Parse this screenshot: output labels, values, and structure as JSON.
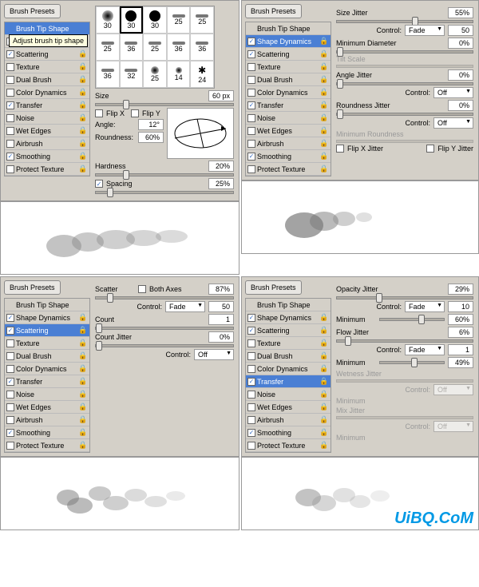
{
  "common": {
    "brush_presets_btn": "Brush Presets",
    "options": {
      "brush_tip_shape": "Brush Tip Shape",
      "shape_dynamics": "Shape Dynamics",
      "scattering": "Scattering",
      "texture": "Texture",
      "dual_brush": "Dual Brush",
      "color_dynamics": "Color Dynamics",
      "transfer": "Transfer",
      "noise": "Noise",
      "wet_edges": "Wet Edges",
      "airbrush": "Airbrush",
      "smoothing": "Smoothing",
      "protect_texture": "Protect Texture"
    },
    "tooltip": "Adjust brush tip shape",
    "control_label": "Control:",
    "fade": "Fade",
    "off": "Off"
  },
  "p1": {
    "brushes": [
      "30",
      "30",
      "30",
      "25",
      "25",
      "25",
      "36",
      "25",
      "36",
      "36",
      "36",
      "32",
      "25",
      "14",
      "24"
    ],
    "size_label": "Size",
    "size_val": "60 px",
    "flip_x": "Flip X",
    "flip_y": "Flip Y",
    "angle_label": "Angle:",
    "angle_val": "12°",
    "roundness_label": "Roundness:",
    "roundness_val": "60%",
    "hardness_label": "Hardness",
    "hardness_val": "20%",
    "spacing_label": "Spacing",
    "spacing_val": "25%"
  },
  "p2": {
    "size_jitter": "Size Jitter",
    "size_jitter_val": "55%",
    "fade_val": "50",
    "min_diameter": "Minimum Diameter",
    "min_diameter_val": "0%",
    "tilt_scale": "Tilt Scale",
    "angle_jitter": "Angle Jitter",
    "angle_jitter_val": "0%",
    "roundness_jitter": "Roundness Jitter",
    "roundness_jitter_val": "0%",
    "min_roundness": "Minimum Roundness",
    "flip_x_jitter": "Flip X Jitter",
    "flip_y_jitter": "Flip Y Jitter"
  },
  "p3": {
    "scatter": "Scatter",
    "both_axes": "Both Axes",
    "scatter_val": "87%",
    "fade_val": "50",
    "count": "Count",
    "count_val": "1",
    "count_jitter": "Count Jitter",
    "count_jitter_val": "0%"
  },
  "p4": {
    "opacity_jitter": "Opacity Jitter",
    "opacity_jitter_val": "29%",
    "fade_val1": "10",
    "minimum": "Minimum",
    "min_val1": "60%",
    "flow_jitter": "Flow Jitter",
    "flow_jitter_val": "6%",
    "fade_val2": "1",
    "min_val2": "49%",
    "wetness_jitter": "Wetness Jitter",
    "mix_jitter": "Mix Jitter"
  },
  "watermark": "UiBQ.CoM"
}
